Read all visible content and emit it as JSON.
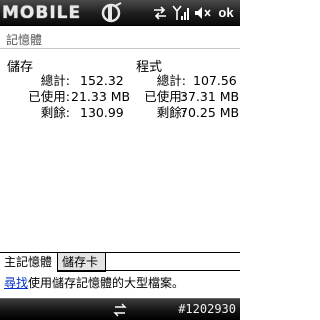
{
  "titlebar": {
    "brand_text": "MOBILE"
  },
  "header": {
    "title": "記憶體"
  },
  "storage": {
    "heading": "儲存",
    "rows": [
      {
        "label": "總計:",
        "value": "152.32"
      },
      {
        "label": "已使用:",
        "value": "21.33 MB"
      },
      {
        "label": "剩餘:",
        "value": "130.99"
      }
    ]
  },
  "program": {
    "heading": "程式",
    "rows": [
      {
        "label": "總計:",
        "value": "107.56"
      },
      {
        "label": "已使用:",
        "value": "37.31 MB"
      },
      {
        "label": "剩餘:",
        "value": "70.25 MB"
      }
    ]
  },
  "tabs": [
    {
      "label": "主記憶體",
      "active": true
    },
    {
      "label": "儲存卡",
      "active": false
    }
  ],
  "find": {
    "link_text": "尋找",
    "rest_text": "使用儲存記憶體的大型檔案。"
  },
  "menubar": {
    "build_number": "#1202930"
  },
  "colors": {
    "link": "#0033cc",
    "bar_dark": "#111111"
  }
}
